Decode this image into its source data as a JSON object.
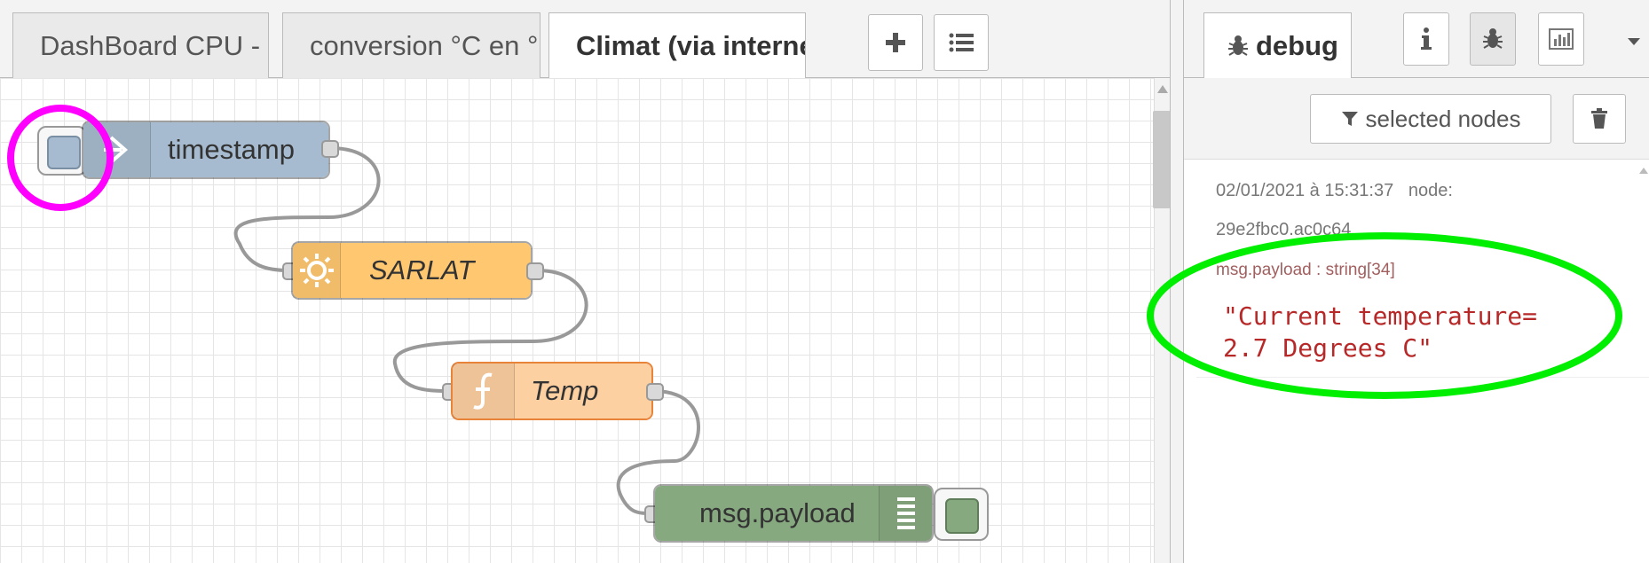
{
  "workspace": {
    "tabs": [
      {
        "label": "DashBoard CPU - Dis",
        "active": false
      },
      {
        "label": "conversion °C en °F",
        "active": false
      },
      {
        "label": "Climat (via internet)",
        "active": true
      }
    ],
    "add_tab_icon": "plus-icon",
    "tab_list_icon": "list-icon"
  },
  "flow": {
    "nodes": [
      {
        "id": "inject",
        "label": "timestamp",
        "color": "#a6bbcf",
        "icon": "arrow-in-icon"
      },
      {
        "id": "weather",
        "label": "SARLAT",
        "color": "#ffc870",
        "icon": "sun-icon"
      },
      {
        "id": "function",
        "label": "Temp",
        "color": "#fdd0a2",
        "icon": "function-icon"
      },
      {
        "id": "debug",
        "label": "msg.payload",
        "color": "#87a980",
        "icon": "list-lines-icon"
      }
    ]
  },
  "sidebar": {
    "active_tab_label": "debug",
    "tab_icons": [
      "info-icon",
      "bug-icon",
      "chart-icon",
      "caret-down-icon"
    ],
    "filter_label": "selected nodes",
    "filter_icon": "funnel-icon",
    "clear_icon": "trash-icon",
    "message": {
      "timestamp": "02/01/2021 à 15:31:37",
      "node_label": "node:",
      "node_id": "29e2fbc0.ac0c64",
      "type_label": "msg.payload : string[34]",
      "value_line1": "\"Current temperature=",
      "value_line2": "2.7 Degrees C\""
    }
  },
  "annotations": {
    "inject_button_circle_color": "#ff00ff",
    "message_ellipse_color": "#00ee00"
  }
}
